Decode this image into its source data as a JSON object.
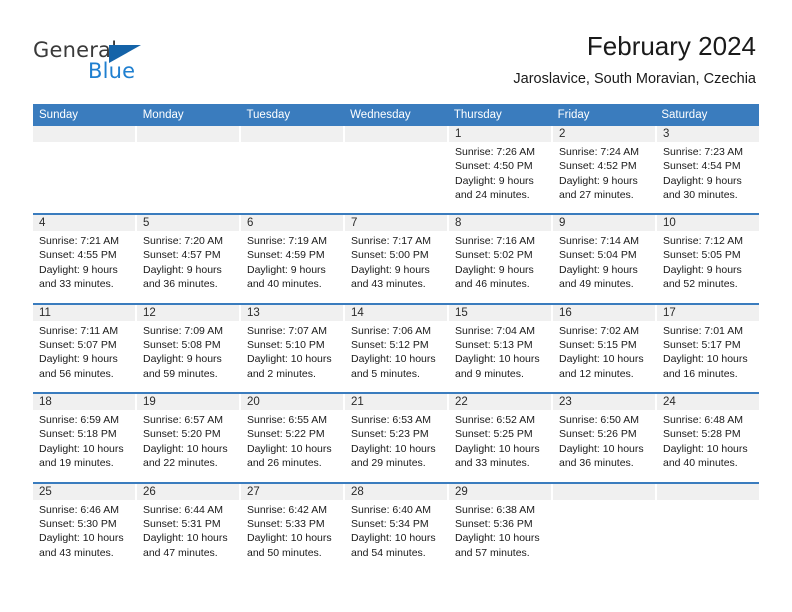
{
  "brand": {
    "name_part1": "General",
    "name_part2": "Blue",
    "triangle_icon": "triangle-logo-icon",
    "accent_color": "#1463a8",
    "blue_text_color": "#1f7fd0"
  },
  "header": {
    "month_title": "February 2024",
    "location": "Jaroslavice, South Moravian, Czechia"
  },
  "calendar": {
    "header_color": "#3a7cbe",
    "weekdays": [
      "Sunday",
      "Monday",
      "Tuesday",
      "Wednesday",
      "Thursday",
      "Friday",
      "Saturday"
    ],
    "weeks": [
      [
        {
          "day": "",
          "lines": []
        },
        {
          "day": "",
          "lines": []
        },
        {
          "day": "",
          "lines": []
        },
        {
          "day": "",
          "lines": []
        },
        {
          "day": "1",
          "lines": [
            "Sunrise: 7:26 AM",
            "Sunset: 4:50 PM",
            "Daylight: 9 hours",
            "and 24 minutes."
          ]
        },
        {
          "day": "2",
          "lines": [
            "Sunrise: 7:24 AM",
            "Sunset: 4:52 PM",
            "Daylight: 9 hours",
            "and 27 minutes."
          ]
        },
        {
          "day": "3",
          "lines": [
            "Sunrise: 7:23 AM",
            "Sunset: 4:54 PM",
            "Daylight: 9 hours",
            "and 30 minutes."
          ]
        }
      ],
      [
        {
          "day": "4",
          "lines": [
            "Sunrise: 7:21 AM",
            "Sunset: 4:55 PM",
            "Daylight: 9 hours",
            "and 33 minutes."
          ]
        },
        {
          "day": "5",
          "lines": [
            "Sunrise: 7:20 AM",
            "Sunset: 4:57 PM",
            "Daylight: 9 hours",
            "and 36 minutes."
          ]
        },
        {
          "day": "6",
          "lines": [
            "Sunrise: 7:19 AM",
            "Sunset: 4:59 PM",
            "Daylight: 9 hours",
            "and 40 minutes."
          ]
        },
        {
          "day": "7",
          "lines": [
            "Sunrise: 7:17 AM",
            "Sunset: 5:00 PM",
            "Daylight: 9 hours",
            "and 43 minutes."
          ]
        },
        {
          "day": "8",
          "lines": [
            "Sunrise: 7:16 AM",
            "Sunset: 5:02 PM",
            "Daylight: 9 hours",
            "and 46 minutes."
          ]
        },
        {
          "day": "9",
          "lines": [
            "Sunrise: 7:14 AM",
            "Sunset: 5:04 PM",
            "Daylight: 9 hours",
            "and 49 minutes."
          ]
        },
        {
          "day": "10",
          "lines": [
            "Sunrise: 7:12 AM",
            "Sunset: 5:05 PM",
            "Daylight: 9 hours",
            "and 52 minutes."
          ]
        }
      ],
      [
        {
          "day": "11",
          "lines": [
            "Sunrise: 7:11 AM",
            "Sunset: 5:07 PM",
            "Daylight: 9 hours",
            "and 56 minutes."
          ]
        },
        {
          "day": "12",
          "lines": [
            "Sunrise: 7:09 AM",
            "Sunset: 5:08 PM",
            "Daylight: 9 hours",
            "and 59 minutes."
          ]
        },
        {
          "day": "13",
          "lines": [
            "Sunrise: 7:07 AM",
            "Sunset: 5:10 PM",
            "Daylight: 10 hours",
            "and 2 minutes."
          ]
        },
        {
          "day": "14",
          "lines": [
            "Sunrise: 7:06 AM",
            "Sunset: 5:12 PM",
            "Daylight: 10 hours",
            "and 5 minutes."
          ]
        },
        {
          "day": "15",
          "lines": [
            "Sunrise: 7:04 AM",
            "Sunset: 5:13 PM",
            "Daylight: 10 hours",
            "and 9 minutes."
          ]
        },
        {
          "day": "16",
          "lines": [
            "Sunrise: 7:02 AM",
            "Sunset: 5:15 PM",
            "Daylight: 10 hours",
            "and 12 minutes."
          ]
        },
        {
          "day": "17",
          "lines": [
            "Sunrise: 7:01 AM",
            "Sunset: 5:17 PM",
            "Daylight: 10 hours",
            "and 16 minutes."
          ]
        }
      ],
      [
        {
          "day": "18",
          "lines": [
            "Sunrise: 6:59 AM",
            "Sunset: 5:18 PM",
            "Daylight: 10 hours",
            "and 19 minutes."
          ]
        },
        {
          "day": "19",
          "lines": [
            "Sunrise: 6:57 AM",
            "Sunset: 5:20 PM",
            "Daylight: 10 hours",
            "and 22 minutes."
          ]
        },
        {
          "day": "20",
          "lines": [
            "Sunrise: 6:55 AM",
            "Sunset: 5:22 PM",
            "Daylight: 10 hours",
            "and 26 minutes."
          ]
        },
        {
          "day": "21",
          "lines": [
            "Sunrise: 6:53 AM",
            "Sunset: 5:23 PM",
            "Daylight: 10 hours",
            "and 29 minutes."
          ]
        },
        {
          "day": "22",
          "lines": [
            "Sunrise: 6:52 AM",
            "Sunset: 5:25 PM",
            "Daylight: 10 hours",
            "and 33 minutes."
          ]
        },
        {
          "day": "23",
          "lines": [
            "Sunrise: 6:50 AM",
            "Sunset: 5:26 PM",
            "Daylight: 10 hours",
            "and 36 minutes."
          ]
        },
        {
          "day": "24",
          "lines": [
            "Sunrise: 6:48 AM",
            "Sunset: 5:28 PM",
            "Daylight: 10 hours",
            "and 40 minutes."
          ]
        }
      ],
      [
        {
          "day": "25",
          "lines": [
            "Sunrise: 6:46 AM",
            "Sunset: 5:30 PM",
            "Daylight: 10 hours",
            "and 43 minutes."
          ]
        },
        {
          "day": "26",
          "lines": [
            "Sunrise: 6:44 AM",
            "Sunset: 5:31 PM",
            "Daylight: 10 hours",
            "and 47 minutes."
          ]
        },
        {
          "day": "27",
          "lines": [
            "Sunrise: 6:42 AM",
            "Sunset: 5:33 PM",
            "Daylight: 10 hours",
            "and 50 minutes."
          ]
        },
        {
          "day": "28",
          "lines": [
            "Sunrise: 6:40 AM",
            "Sunset: 5:34 PM",
            "Daylight: 10 hours",
            "and 54 minutes."
          ]
        },
        {
          "day": "29",
          "lines": [
            "Sunrise: 6:38 AM",
            "Sunset: 5:36 PM",
            "Daylight: 10 hours",
            "and 57 minutes."
          ]
        },
        {
          "day": "",
          "lines": []
        },
        {
          "day": "",
          "lines": []
        }
      ]
    ]
  }
}
